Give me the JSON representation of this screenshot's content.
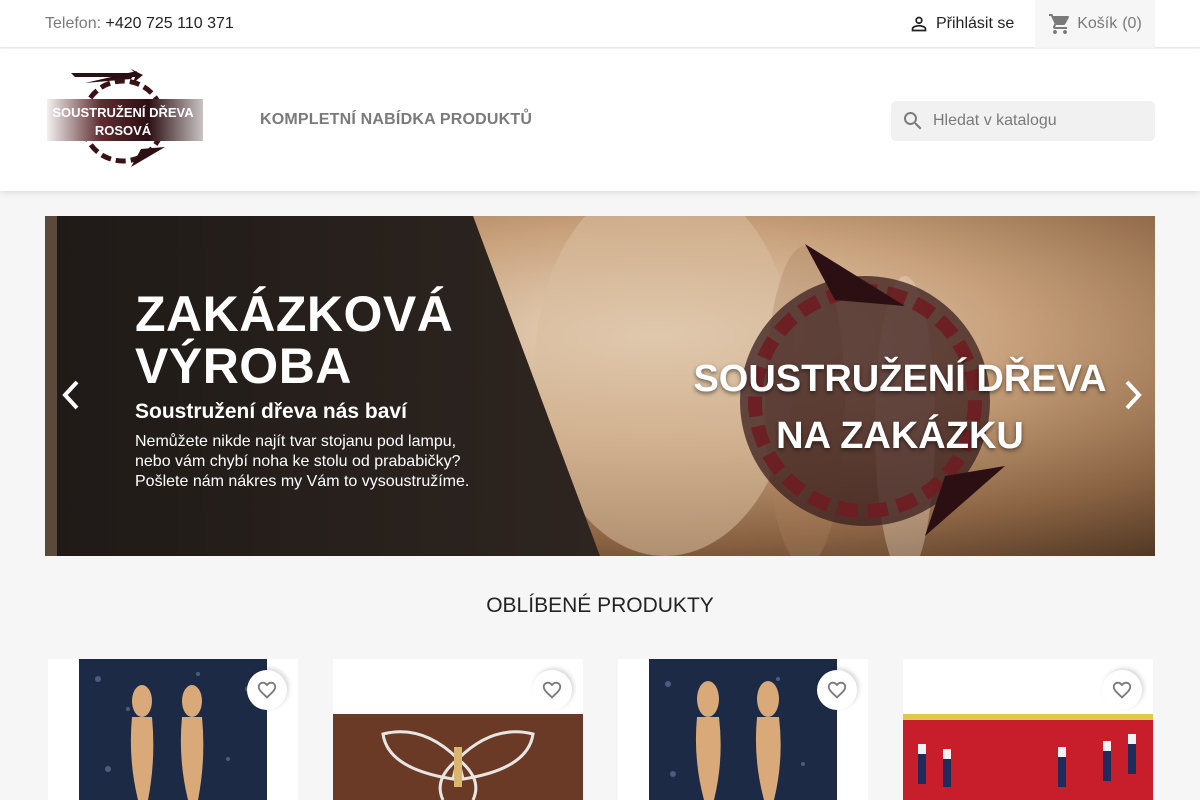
{
  "topbar": {
    "phone_label": "Telefon:",
    "phone_number": "+420 725 110 371",
    "login_label": "Přihlásit se",
    "cart_label": "Košík",
    "cart_count": "(0)"
  },
  "header": {
    "logo_line1": "SOUSTRUŽENÍ DŘEVA",
    "logo_line2": "ROSOVÁ",
    "nav_link": "KOMPLETNÍ NABÍDKA PRODUKTŮ",
    "search_placeholder": "Hledat v katalogu"
  },
  "hero": {
    "title_line1": "ZAKÁZKOVÁ",
    "title_line2": "VÝROBA",
    "subtitle": "Soustružení dřeva nás baví",
    "text": "Nemůžete nikde najít tvar stojanu pod lampu, nebo vám chybí noha ke stolu od prababičky? Pošlete nám nákres my Vám to vysoustružíme.",
    "image_line1": "SOUSTRUŽENÍ DŘEVA",
    "image_line2": "NA ZAKÁZKU"
  },
  "products": {
    "section_title": "OBLÍBENÉ PRODUKTY"
  },
  "colors": {
    "accent": "#7a7a7a",
    "brand_red": "#3a1114",
    "text": "#232323"
  },
  "icons": [
    "person-icon",
    "cart-icon",
    "search-icon",
    "chevron-left-icon",
    "chevron-right-icon",
    "heart-outline-icon"
  ]
}
